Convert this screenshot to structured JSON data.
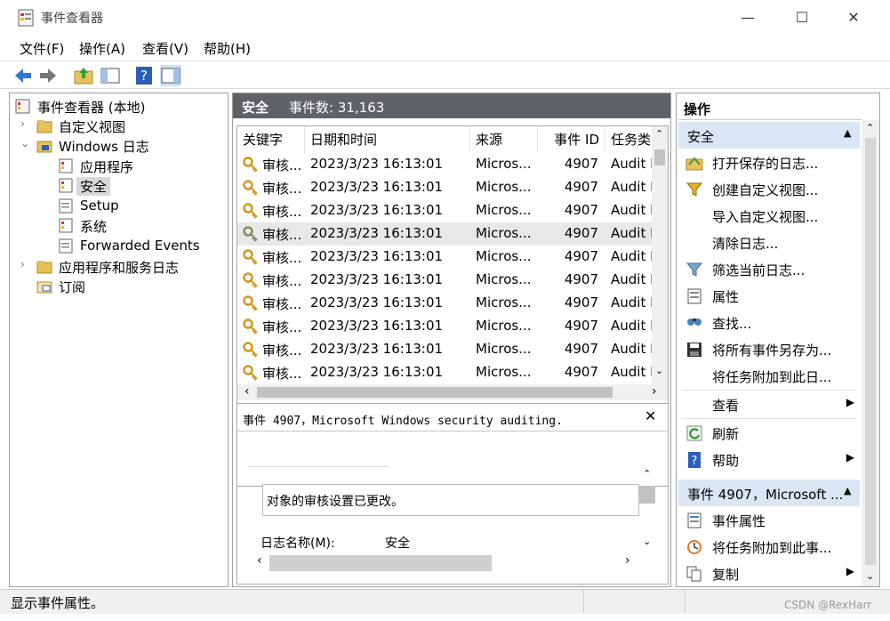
{
  "window": {
    "title": "事件查看器",
    "minimize": "—",
    "maximize": "☐",
    "close": "✕"
  },
  "menu": [
    "文件(F)",
    "操作(A)",
    "查看(V)",
    "帮助(H)"
  ],
  "tree": {
    "root": "事件查看器 (本地)",
    "custom_views": "自定义视图",
    "windows_logs": "Windows 日志",
    "logs": [
      "应用程序",
      "安全",
      "Setup",
      "系统",
      "Forwarded Events"
    ],
    "app_service_logs": "应用程序和服务日志",
    "subscriptions": "订阅"
  },
  "center": {
    "log_name": "安全",
    "event_count": "事件数: 31,163",
    "columns": [
      "关键字",
      "日期和时间",
      "来源",
      "事件 ID",
      "任务类"
    ],
    "rows": [
      {
        "keyword": "审核...",
        "datetime": "2023/3/23 16:13:01",
        "source": "Micros...",
        "id": "4907",
        "task": "Audit P"
      },
      {
        "keyword": "审核...",
        "datetime": "2023/3/23 16:13:01",
        "source": "Micros...",
        "id": "4907",
        "task": "Audit P"
      },
      {
        "keyword": "审核...",
        "datetime": "2023/3/23 16:13:01",
        "source": "Micros...",
        "id": "4907",
        "task": "Audit P"
      },
      {
        "keyword": "审核...",
        "datetime": "2023/3/23 16:13:01",
        "source": "Micros...",
        "id": "4907",
        "task": "Audit P"
      },
      {
        "keyword": "审核...",
        "datetime": "2023/3/23 16:13:01",
        "source": "Micros...",
        "id": "4907",
        "task": "Audit P"
      },
      {
        "keyword": "审核...",
        "datetime": "2023/3/23 16:13:01",
        "source": "Micros...",
        "id": "4907",
        "task": "Audit P"
      },
      {
        "keyword": "审核...",
        "datetime": "2023/3/23 16:13:01",
        "source": "Micros...",
        "id": "4907",
        "task": "Audit P"
      },
      {
        "keyword": "审核...",
        "datetime": "2023/3/23 16:13:01",
        "source": "Micros...",
        "id": "4907",
        "task": "Audit P"
      },
      {
        "keyword": "审核...",
        "datetime": "2023/3/23 16:13:01",
        "source": "Micros...",
        "id": "4907",
        "task": "Audit P"
      },
      {
        "keyword": "审核...",
        "datetime": "2023/3/23 16:13:01",
        "source": "Micros...",
        "id": "4907",
        "task": "Audit P"
      }
    ],
    "detail_title": "事件 4907，Microsoft Windows security auditing.",
    "detail_close": "✕",
    "detail_message": "对象的审核设置已更改。",
    "detail_field_label": "日志名称(M):",
    "detail_field_value": "安全"
  },
  "actions": {
    "header": "操作",
    "section1": "安全",
    "items1": [
      "打开保存的日志...",
      "创建自定义视图...",
      "导入自定义视图...",
      "清除日志...",
      "筛选当前日志...",
      "属性",
      "查找...",
      "将所有事件另存为...",
      "将任务附加到此日...",
      "查看",
      "刷新",
      "帮助"
    ],
    "section2": "事件 4907，Microsoft ...",
    "items2": [
      "事件属性",
      "将任务附加到此事...",
      "复制"
    ]
  },
  "status": "显示事件属性。",
  "watermark": "CSDN @RexHarr",
  "colors": {
    "accent": "#dbe6f4",
    "header_dark": "#5f6367",
    "selection": "#e8e8e8"
  }
}
